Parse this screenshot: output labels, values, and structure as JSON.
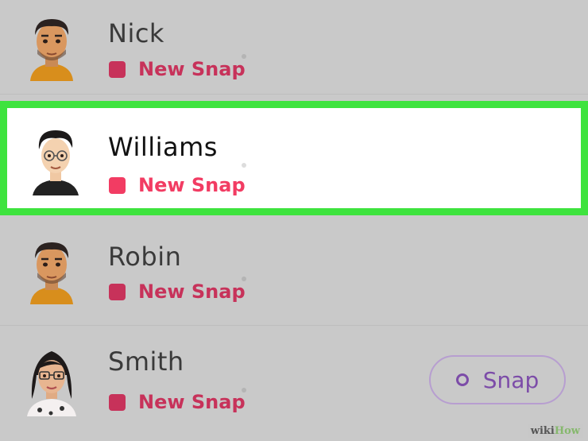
{
  "contacts": [
    {
      "name": "Nick",
      "status": "New Snap",
      "avatar": "male-bitmoji-beard",
      "highlighted": false
    },
    {
      "name": "Williams",
      "status": "New Snap",
      "avatar": "male-bitmoji-glasses",
      "highlighted": true
    },
    {
      "name": "Robin",
      "status": "New Snap",
      "avatar": "male-bitmoji-beard",
      "highlighted": false
    },
    {
      "name": "Smith",
      "status": "New Snap",
      "avatar": "female-bitmoji-glasses",
      "highlighted": false
    }
  ],
  "snap_button": {
    "label": "Snap"
  },
  "watermark": {
    "part1": "wiki",
    "part2": "How"
  },
  "colors": {
    "highlight_border": "#3ee33e",
    "new_snap_red": "#f23c63",
    "snap_purple": "#7c4ca8",
    "background": "#c9c9c9"
  }
}
